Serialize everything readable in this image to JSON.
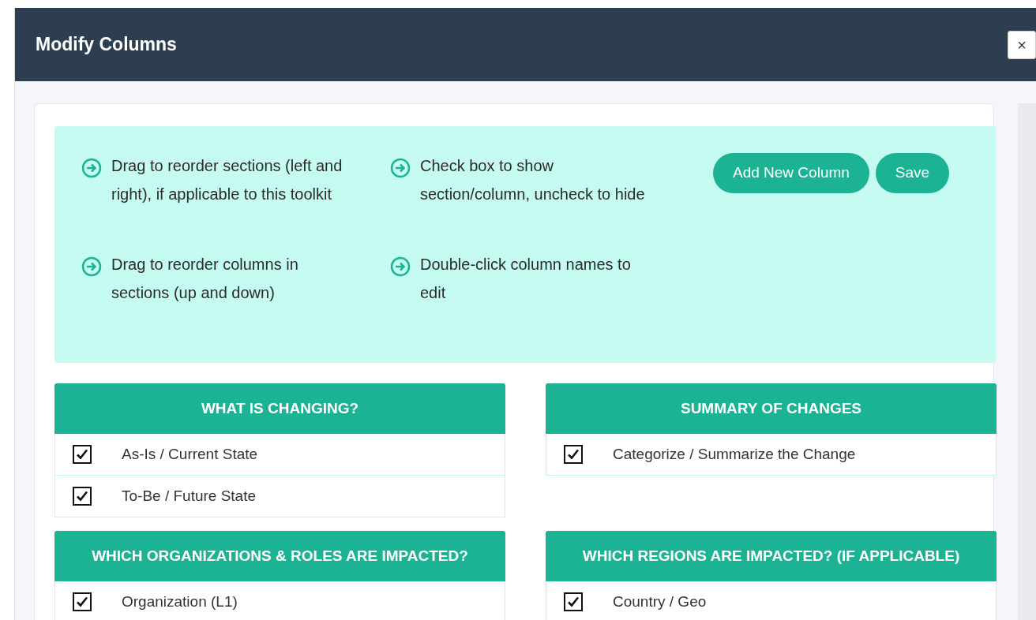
{
  "modal": {
    "title": "Modify Columns",
    "close": "×"
  },
  "instructions": [
    {
      "text": "Drag to reorder sections (left and right), if applicable to this toolkit"
    },
    {
      "text": "Check box to show section/column, uncheck to hide"
    },
    {
      "text": "Drag to reorder columns in sections (up and down)"
    },
    {
      "text": "Double-click column names to edit"
    }
  ],
  "buttons": [
    "Add New Column",
    "Save"
  ],
  "sections": [
    {
      "title": "WHAT IS CHANGING?",
      "columns": [
        {
          "label": "As-Is / Current State",
          "checked": true
        },
        {
          "label": "To-Be / Future State",
          "checked": true
        }
      ]
    },
    {
      "title": "SUMMARY OF CHANGES",
      "columns": [
        {
          "label": "Categorize / Summarize the Change",
          "checked": true
        }
      ]
    },
    {
      "title": "WHICH ORGANIZATIONS & ROLES ARE IMPACTED?",
      "columns": [
        {
          "label": "Organization (L1)",
          "checked": true
        }
      ]
    },
    {
      "title": "WHICH REGIONS ARE IMPACTED? (IF APPLICABLE)",
      "columns": [
        {
          "label": "Country / Geo",
          "checked": true
        }
      ]
    }
  ]
}
